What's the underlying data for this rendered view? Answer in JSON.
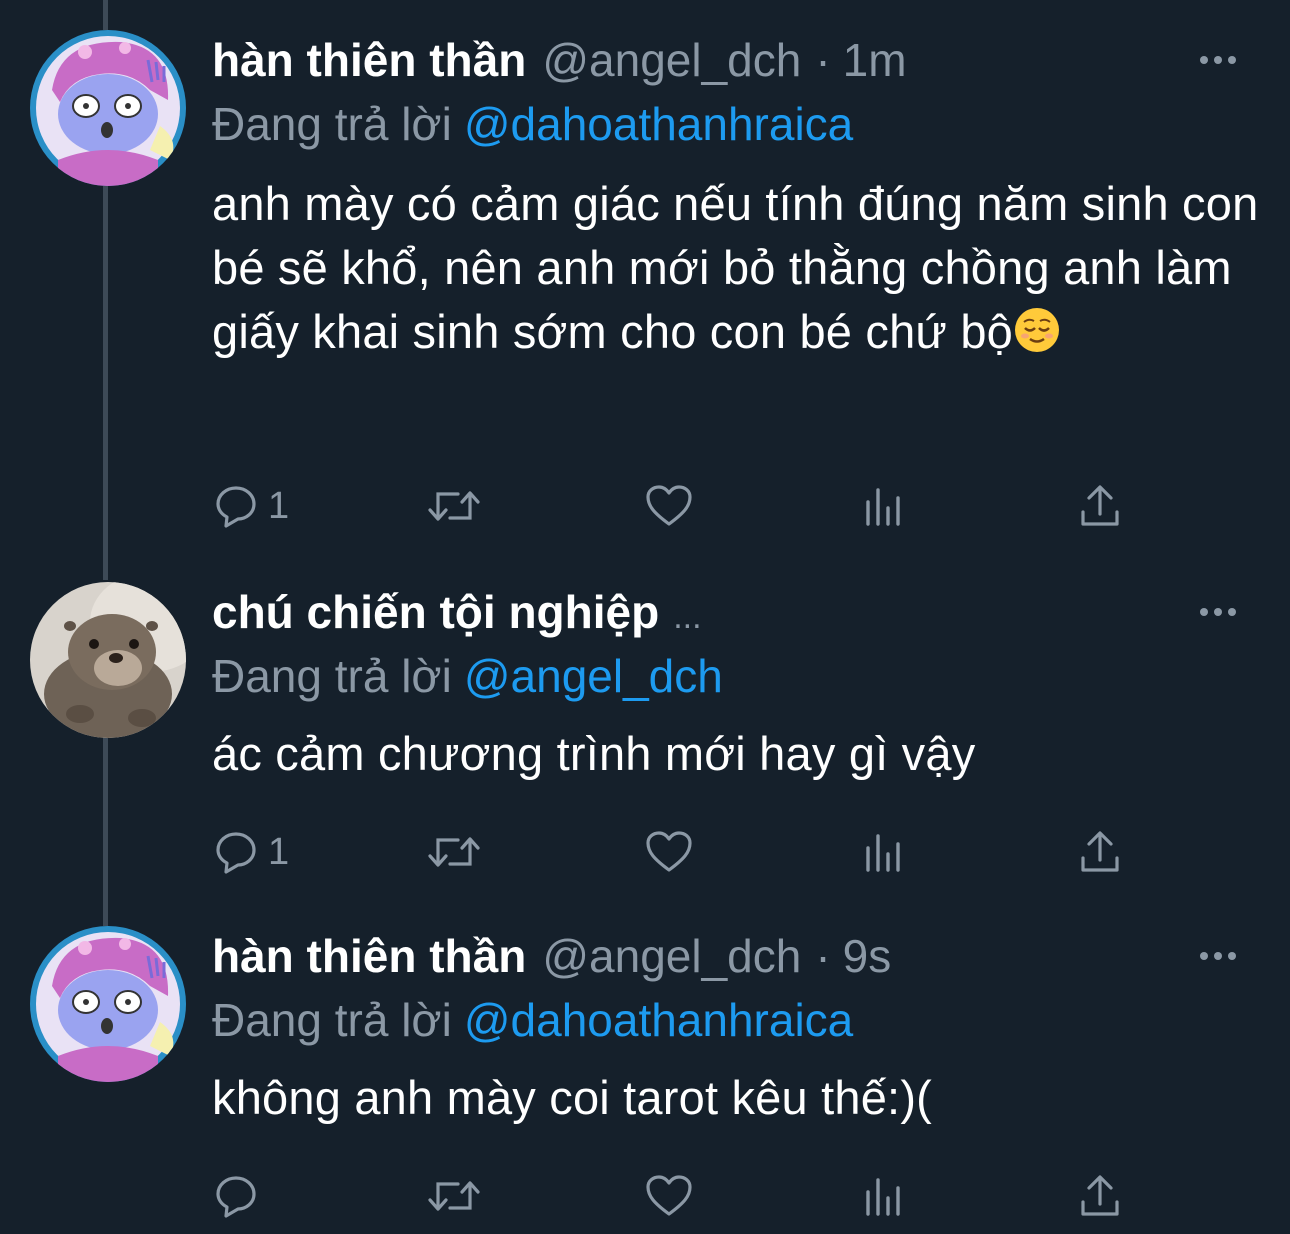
{
  "colors": {
    "background": "#15202b",
    "primary_text": "#ffffff",
    "secondary_text": "#8b98a5",
    "link": "#1d9bf0",
    "thread_line": "#3d4a57"
  },
  "tweets": [
    {
      "name": "hàn thiên thần",
      "handle": "@angel_dch",
      "dot": "·",
      "time": "1m",
      "reply_prefix": "Đang trả lời",
      "reply_mention": "@dahoathanhraica",
      "text": "anh mày có cảm giác nếu tính đúng năm sinh con bé sẽ khổ, nên anh mới bỏ thằng chồng anh làm giấy khai sinh sớm cho con bé chứ bộ",
      "emoji": "relieved-face",
      "reply_count": "1",
      "avatar": "pastel-character-avatar"
    },
    {
      "name": "chú chiến tội nghiệp",
      "name_truncation": "...",
      "reply_prefix": "Đang trả lời",
      "reply_mention": "@angel_dch",
      "text": "ác cảm chương trình mới hay gì vậy",
      "reply_count": "1",
      "avatar": "otter-photo-avatar"
    },
    {
      "name": "hàn thiên thần",
      "handle": "@angel_dch",
      "dot": "·",
      "time": "9s",
      "reply_prefix": "Đang trả lời",
      "reply_mention": "@dahoathanhraica",
      "text": "không anh mày coi tarot kêu thế:)(",
      "reply_count": "",
      "avatar": "pastel-character-avatar"
    }
  ],
  "icons": {
    "reply": "reply-icon",
    "retweet": "retweet-icon",
    "like": "heart-icon",
    "views": "views-icon",
    "share": "share-icon",
    "more": "more-options-icon"
  }
}
